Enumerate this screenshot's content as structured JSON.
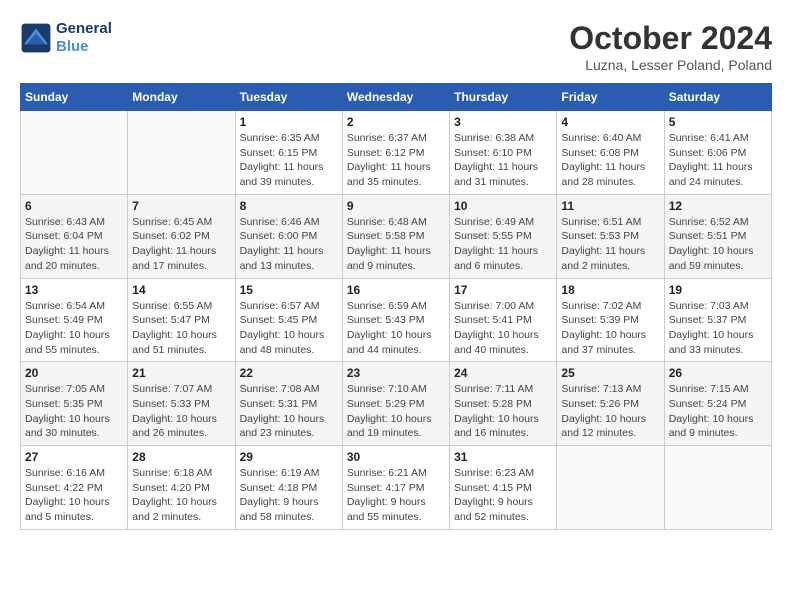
{
  "logo": {
    "line1": "General",
    "line2": "Blue"
  },
  "title": "October 2024",
  "location": "Luzna, Lesser Poland, Poland",
  "days_header": [
    "Sunday",
    "Monday",
    "Tuesday",
    "Wednesday",
    "Thursday",
    "Friday",
    "Saturday"
  ],
  "weeks": [
    [
      {
        "day": "",
        "info": ""
      },
      {
        "day": "",
        "info": ""
      },
      {
        "day": "1",
        "info": "Sunrise: 6:35 AM\nSunset: 6:15 PM\nDaylight: 11 hours and 39 minutes."
      },
      {
        "day": "2",
        "info": "Sunrise: 6:37 AM\nSunset: 6:12 PM\nDaylight: 11 hours and 35 minutes."
      },
      {
        "day": "3",
        "info": "Sunrise: 6:38 AM\nSunset: 6:10 PM\nDaylight: 11 hours and 31 minutes."
      },
      {
        "day": "4",
        "info": "Sunrise: 6:40 AM\nSunset: 6:08 PM\nDaylight: 11 hours and 28 minutes."
      },
      {
        "day": "5",
        "info": "Sunrise: 6:41 AM\nSunset: 6:06 PM\nDaylight: 11 hours and 24 minutes."
      }
    ],
    [
      {
        "day": "6",
        "info": "Sunrise: 6:43 AM\nSunset: 6:04 PM\nDaylight: 11 hours and 20 minutes."
      },
      {
        "day": "7",
        "info": "Sunrise: 6:45 AM\nSunset: 6:02 PM\nDaylight: 11 hours and 17 minutes."
      },
      {
        "day": "8",
        "info": "Sunrise: 6:46 AM\nSunset: 6:00 PM\nDaylight: 11 hours and 13 minutes."
      },
      {
        "day": "9",
        "info": "Sunrise: 6:48 AM\nSunset: 5:58 PM\nDaylight: 11 hours and 9 minutes."
      },
      {
        "day": "10",
        "info": "Sunrise: 6:49 AM\nSunset: 5:55 PM\nDaylight: 11 hours and 6 minutes."
      },
      {
        "day": "11",
        "info": "Sunrise: 6:51 AM\nSunset: 5:53 PM\nDaylight: 11 hours and 2 minutes."
      },
      {
        "day": "12",
        "info": "Sunrise: 6:52 AM\nSunset: 5:51 PM\nDaylight: 10 hours and 59 minutes."
      }
    ],
    [
      {
        "day": "13",
        "info": "Sunrise: 6:54 AM\nSunset: 5:49 PM\nDaylight: 10 hours and 55 minutes."
      },
      {
        "day": "14",
        "info": "Sunrise: 6:55 AM\nSunset: 5:47 PM\nDaylight: 10 hours and 51 minutes."
      },
      {
        "day": "15",
        "info": "Sunrise: 6:57 AM\nSunset: 5:45 PM\nDaylight: 10 hours and 48 minutes."
      },
      {
        "day": "16",
        "info": "Sunrise: 6:59 AM\nSunset: 5:43 PM\nDaylight: 10 hours and 44 minutes."
      },
      {
        "day": "17",
        "info": "Sunrise: 7:00 AM\nSunset: 5:41 PM\nDaylight: 10 hours and 40 minutes."
      },
      {
        "day": "18",
        "info": "Sunrise: 7:02 AM\nSunset: 5:39 PM\nDaylight: 10 hours and 37 minutes."
      },
      {
        "day": "19",
        "info": "Sunrise: 7:03 AM\nSunset: 5:37 PM\nDaylight: 10 hours and 33 minutes."
      }
    ],
    [
      {
        "day": "20",
        "info": "Sunrise: 7:05 AM\nSunset: 5:35 PM\nDaylight: 10 hours and 30 minutes."
      },
      {
        "day": "21",
        "info": "Sunrise: 7:07 AM\nSunset: 5:33 PM\nDaylight: 10 hours and 26 minutes."
      },
      {
        "day": "22",
        "info": "Sunrise: 7:08 AM\nSunset: 5:31 PM\nDaylight: 10 hours and 23 minutes."
      },
      {
        "day": "23",
        "info": "Sunrise: 7:10 AM\nSunset: 5:29 PM\nDaylight: 10 hours and 19 minutes."
      },
      {
        "day": "24",
        "info": "Sunrise: 7:11 AM\nSunset: 5:28 PM\nDaylight: 10 hours and 16 minutes."
      },
      {
        "day": "25",
        "info": "Sunrise: 7:13 AM\nSunset: 5:26 PM\nDaylight: 10 hours and 12 minutes."
      },
      {
        "day": "26",
        "info": "Sunrise: 7:15 AM\nSunset: 5:24 PM\nDaylight: 10 hours and 9 minutes."
      }
    ],
    [
      {
        "day": "27",
        "info": "Sunrise: 6:16 AM\nSunset: 4:22 PM\nDaylight: 10 hours and 5 minutes."
      },
      {
        "day": "28",
        "info": "Sunrise: 6:18 AM\nSunset: 4:20 PM\nDaylight: 10 hours and 2 minutes."
      },
      {
        "day": "29",
        "info": "Sunrise: 6:19 AM\nSunset: 4:18 PM\nDaylight: 9 hours and 58 minutes."
      },
      {
        "day": "30",
        "info": "Sunrise: 6:21 AM\nSunset: 4:17 PM\nDaylight: 9 hours and 55 minutes."
      },
      {
        "day": "31",
        "info": "Sunrise: 6:23 AM\nSunset: 4:15 PM\nDaylight: 9 hours and 52 minutes."
      },
      {
        "day": "",
        "info": ""
      },
      {
        "day": "",
        "info": ""
      }
    ]
  ]
}
